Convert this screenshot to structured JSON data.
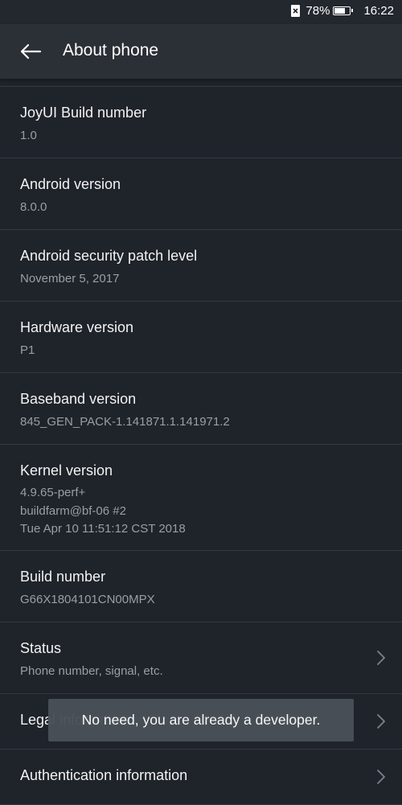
{
  "status_bar": {
    "sim_icon": "no-sim-icon",
    "battery_percent": "78%",
    "battery_level": 0.78,
    "time": "16:22"
  },
  "app_bar": {
    "back_icon": "arrow-left-icon",
    "title": "About phone"
  },
  "settings": {
    "items": [
      {
        "title": "JoyUI Build number",
        "subtitle": "1.0"
      },
      {
        "title": "Android version",
        "subtitle": "8.0.0"
      },
      {
        "title": "Android security patch level",
        "subtitle": "November 5, 2017"
      },
      {
        "title": "Hardware version",
        "subtitle": "P1"
      },
      {
        "title": "Baseband version",
        "subtitle": "845_GEN_PACK-1.141871.1.141971.2"
      },
      {
        "title": "Kernel version",
        "subtitle": "4.9.65-perf+\nbuildfarm@bf-06 #2\nTue Apr 10 11:51:12 CST 2018"
      },
      {
        "title": "Build number",
        "subtitle": "G66X1804101CN00MPX"
      },
      {
        "title": "Status",
        "subtitle": "Phone number, signal, etc.",
        "chevron": "chevron-right-icon"
      },
      {
        "title": "Legal information",
        "chevron": "chevron-right-icon"
      },
      {
        "title": "Authentication information",
        "chevron": "chevron-right-icon"
      }
    ]
  },
  "toast": {
    "message": "No need, you are already a developer."
  },
  "colors": {
    "background": "#1f232a",
    "app_bar": "#2b2f36",
    "divider": "#343941",
    "secondary_text": "#9a9ea5",
    "toast": "#4a5058"
  }
}
